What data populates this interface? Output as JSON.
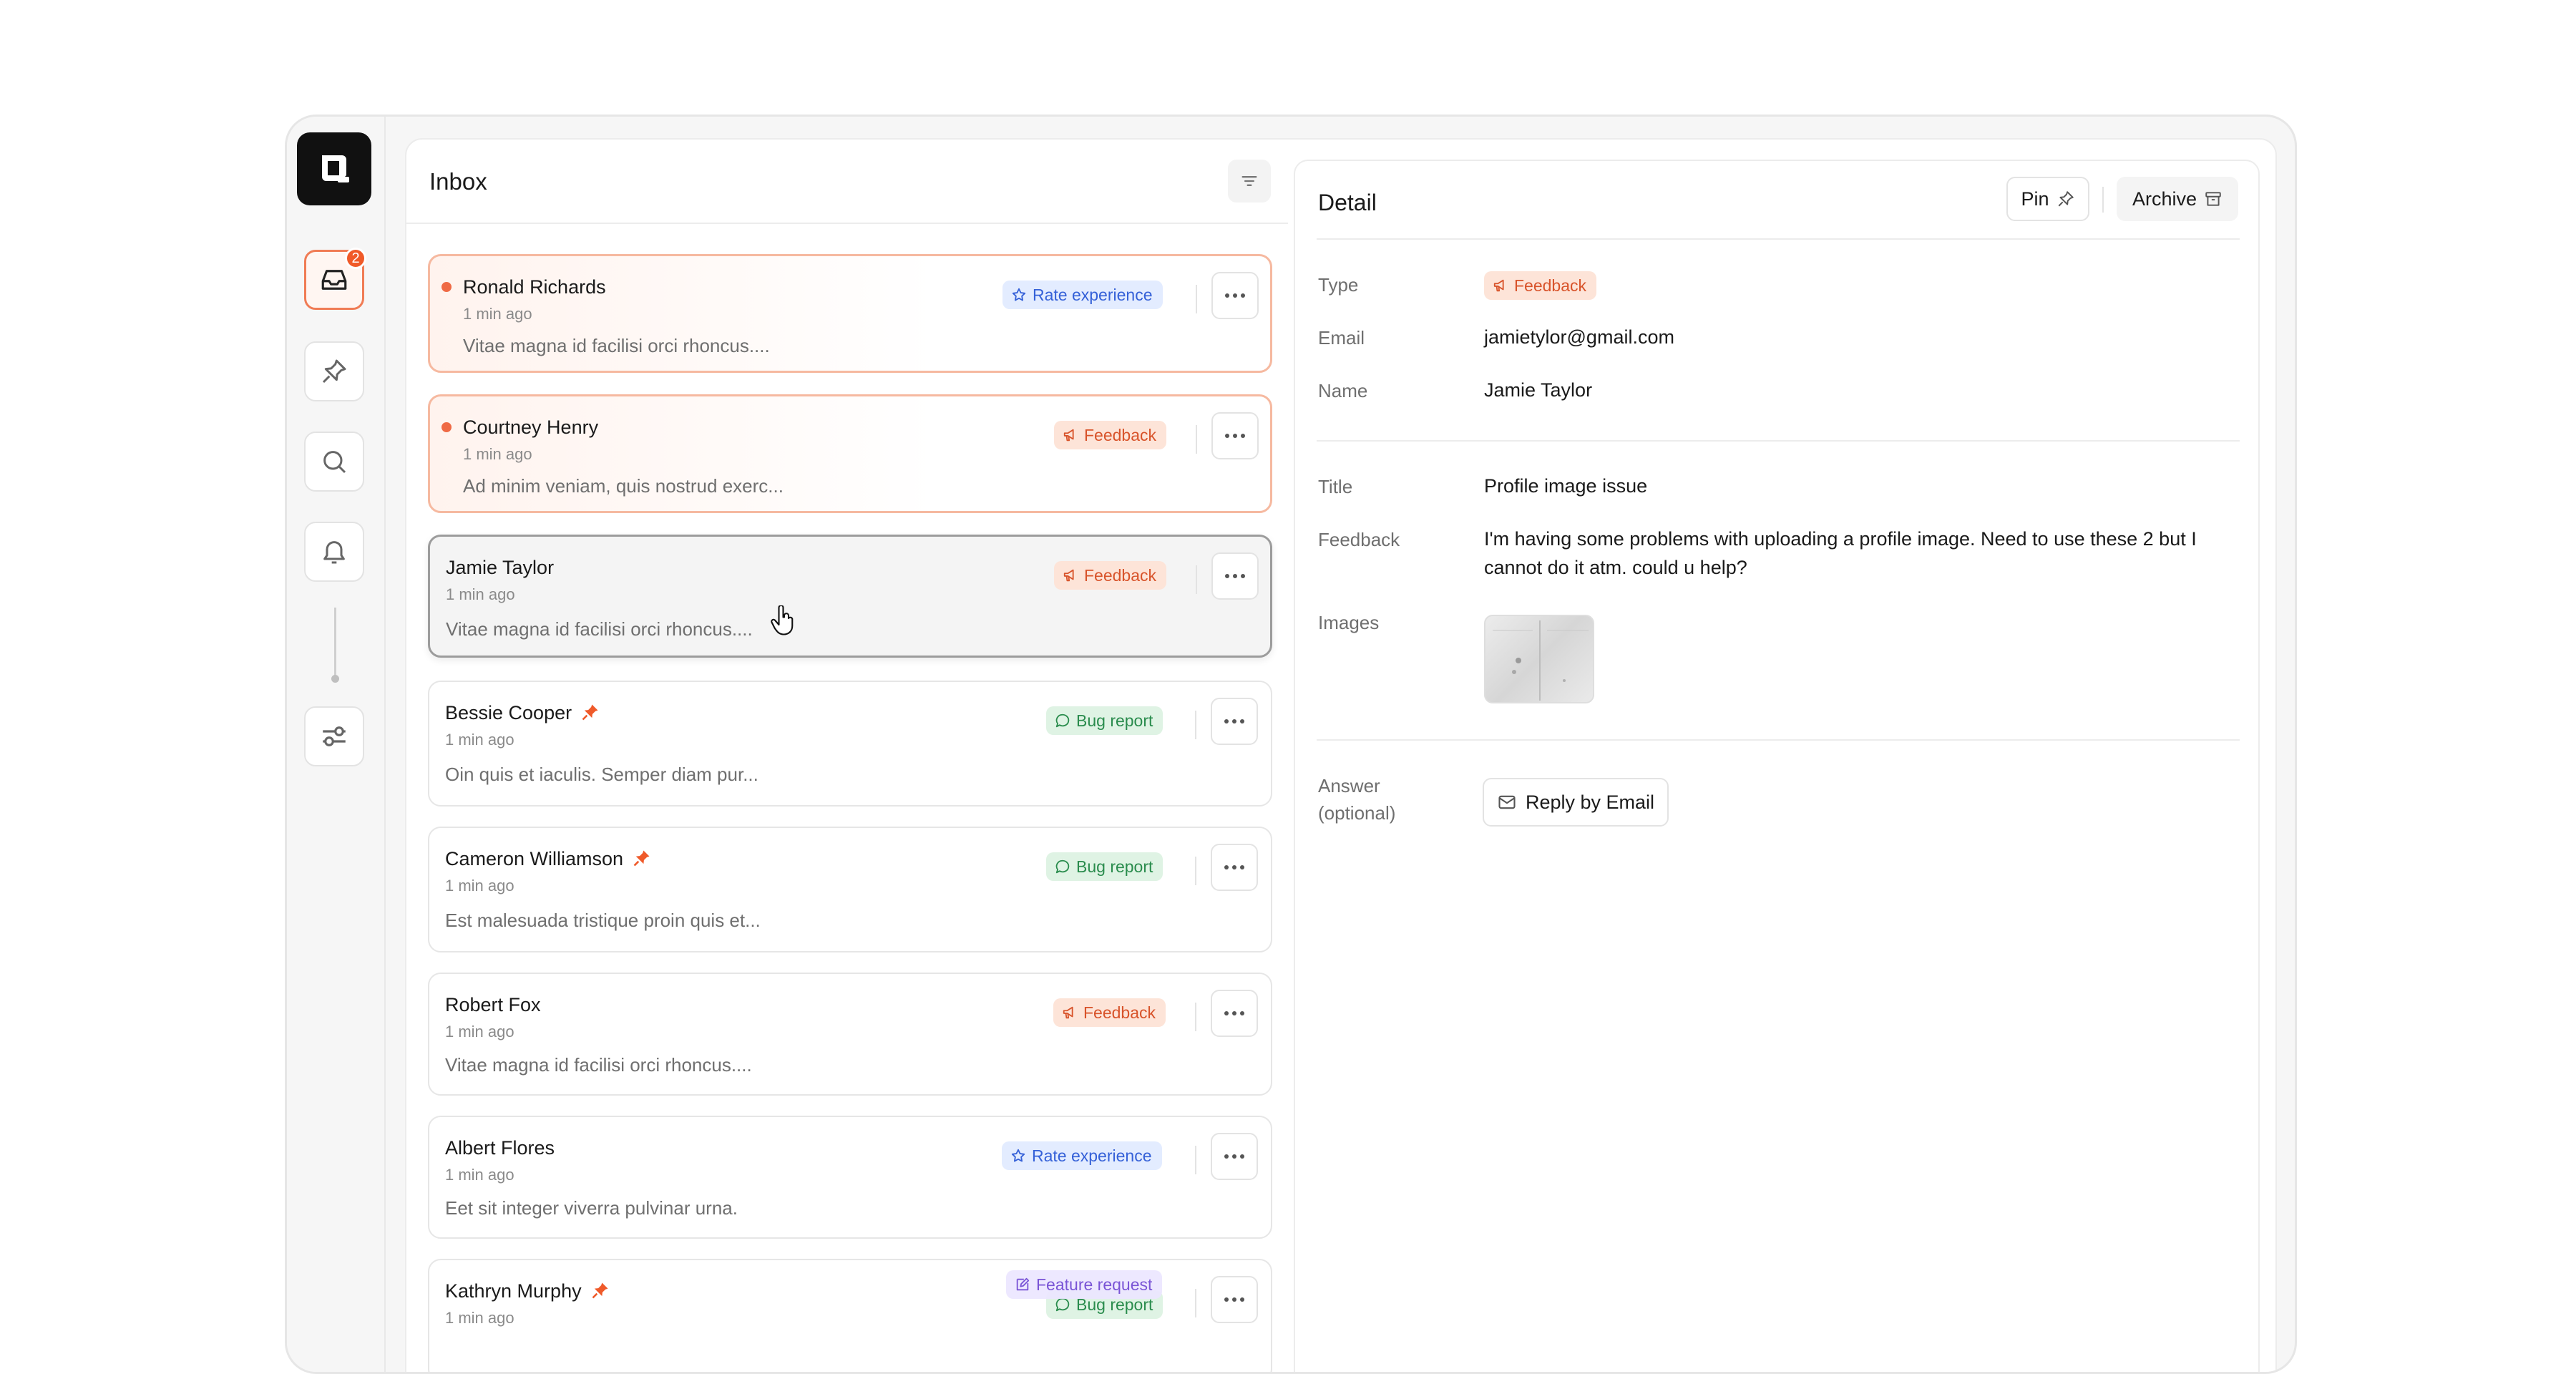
{
  "sidebar": {
    "inbox_badge": "2"
  },
  "inbox": {
    "title": "Inbox",
    "items": [
      {
        "name": "Ronald Richards",
        "time": "1 min ago",
        "preview": "Vitae magna id facilisi orci rhoncus....",
        "tag": "Rate experience"
      },
      {
        "name": "Courtney Henry",
        "time": "1 min ago",
        "preview": "Ad minim veniam, quis nostrud exerc...",
        "tag": "Feedback"
      },
      {
        "name": "Jamie Taylor",
        "time": "1 min ago",
        "preview": "Vitae magna id facilisi orci rhoncus....",
        "tag": "Feedback"
      },
      {
        "name": "Bessie Cooper",
        "time": "1 min ago",
        "preview": "Oin quis et iaculis. Semper diam pur...",
        "tag": "Bug report"
      },
      {
        "name": "Cameron Williamson",
        "time": "1 min ago",
        "preview": "Est malesuada tristique proin quis et...",
        "tag": "Bug report"
      },
      {
        "name": "Robert Fox",
        "time": "1 min ago",
        "preview": "Vitae magna id facilisi orci rhoncus....",
        "tag": "Feedback"
      },
      {
        "name": "Albert Flores",
        "time": "1 min ago",
        "preview": "Eet sit integer viverra pulvinar urna.",
        "tag": "Rate experience"
      },
      {
        "name": "Kathryn Murphy",
        "time": "1 min ago",
        "preview": "",
        "tag": "Feature request",
        "tag2": "Bug report"
      }
    ]
  },
  "detail": {
    "title": "Detail",
    "pin_label": "Pin",
    "archive_label": "Archive",
    "type_label": "Type",
    "type_value": "Feedback",
    "email_label": "Email",
    "email_value": "jamietylor@gmail.com",
    "name_label": "Name",
    "name_value": "Jamie Taylor",
    "title_label": "Title",
    "title_value": "Profile image issue",
    "feedback_label": "Feedback",
    "feedback_value": "I'm having some problems with uploading a profile image. Need to use these 2 but I cannot do it atm. could u help?",
    "images_label": "Images",
    "answer_label_1": "Answer",
    "answer_label_2": "(optional)",
    "reply_label": "Reply by Email"
  },
  "colors": {
    "accent": "#f05a28",
    "rate": "#3561d8",
    "feedback": "#d8532a",
    "bug": "#2a8c4d",
    "feature": "#7a55d6"
  }
}
